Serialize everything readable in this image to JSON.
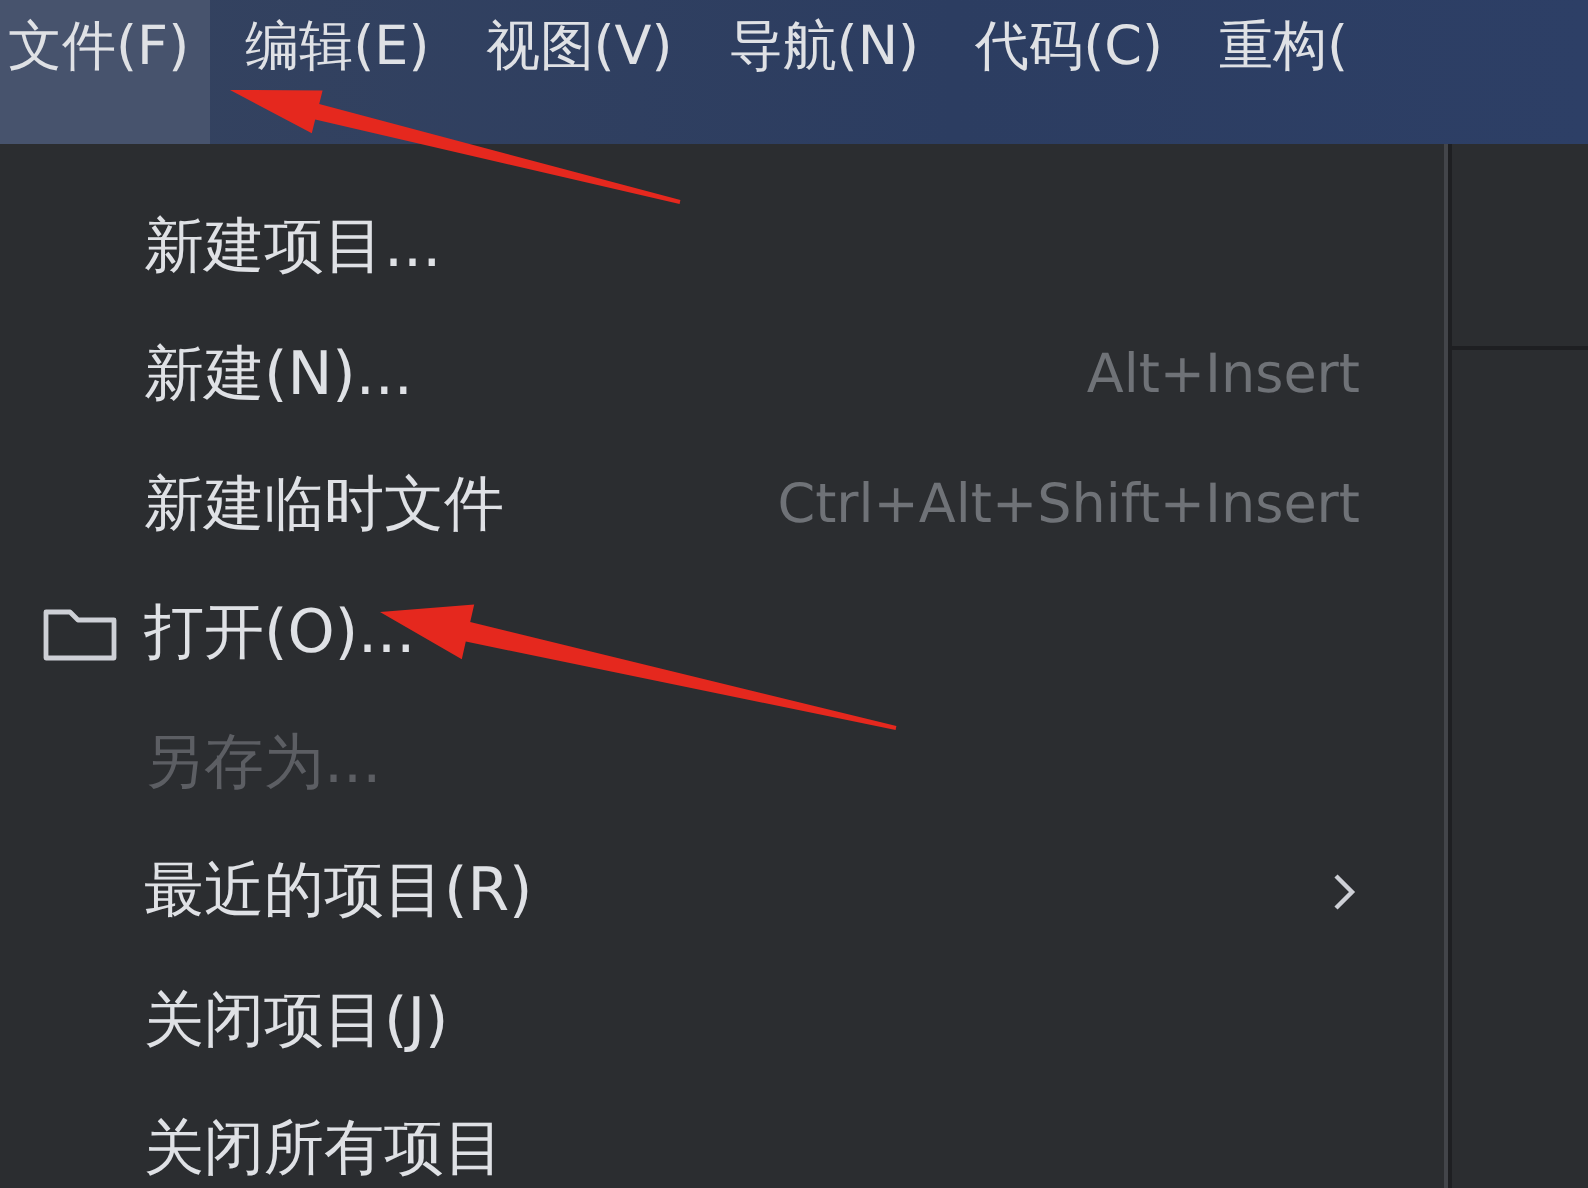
{
  "menu_bar": [
    {
      "label": "文件(F)",
      "selected": true
    },
    {
      "label": "编辑(E)",
      "selected": false
    },
    {
      "label": "视图(V)",
      "selected": false
    },
    {
      "label": "导航(N)",
      "selected": false
    },
    {
      "label": "代码(C)",
      "selected": false
    },
    {
      "label": "重构(",
      "selected": false
    }
  ],
  "file_menu": {
    "items": [
      {
        "kind": "action",
        "label": "新建项目...",
        "disabled": false
      },
      {
        "kind": "action",
        "label": "新建(N)...",
        "shortcut": "Alt+Insert",
        "disabled": false
      },
      {
        "kind": "action",
        "label": "新建临时文件",
        "shortcut": "Ctrl+Alt+Shift+Insert",
        "disabled": false
      },
      {
        "kind": "folder",
        "label": "打开(O)...",
        "disabled": false
      },
      {
        "kind": "action",
        "label": "另存为...",
        "disabled": true
      },
      {
        "kind": "submenu",
        "label": "最近的项目(R)",
        "disabled": false
      },
      {
        "kind": "action",
        "label": "关闭项目(J)",
        "disabled": false
      },
      {
        "kind": "action",
        "label": "关闭所有项目",
        "disabled": false
      }
    ]
  }
}
